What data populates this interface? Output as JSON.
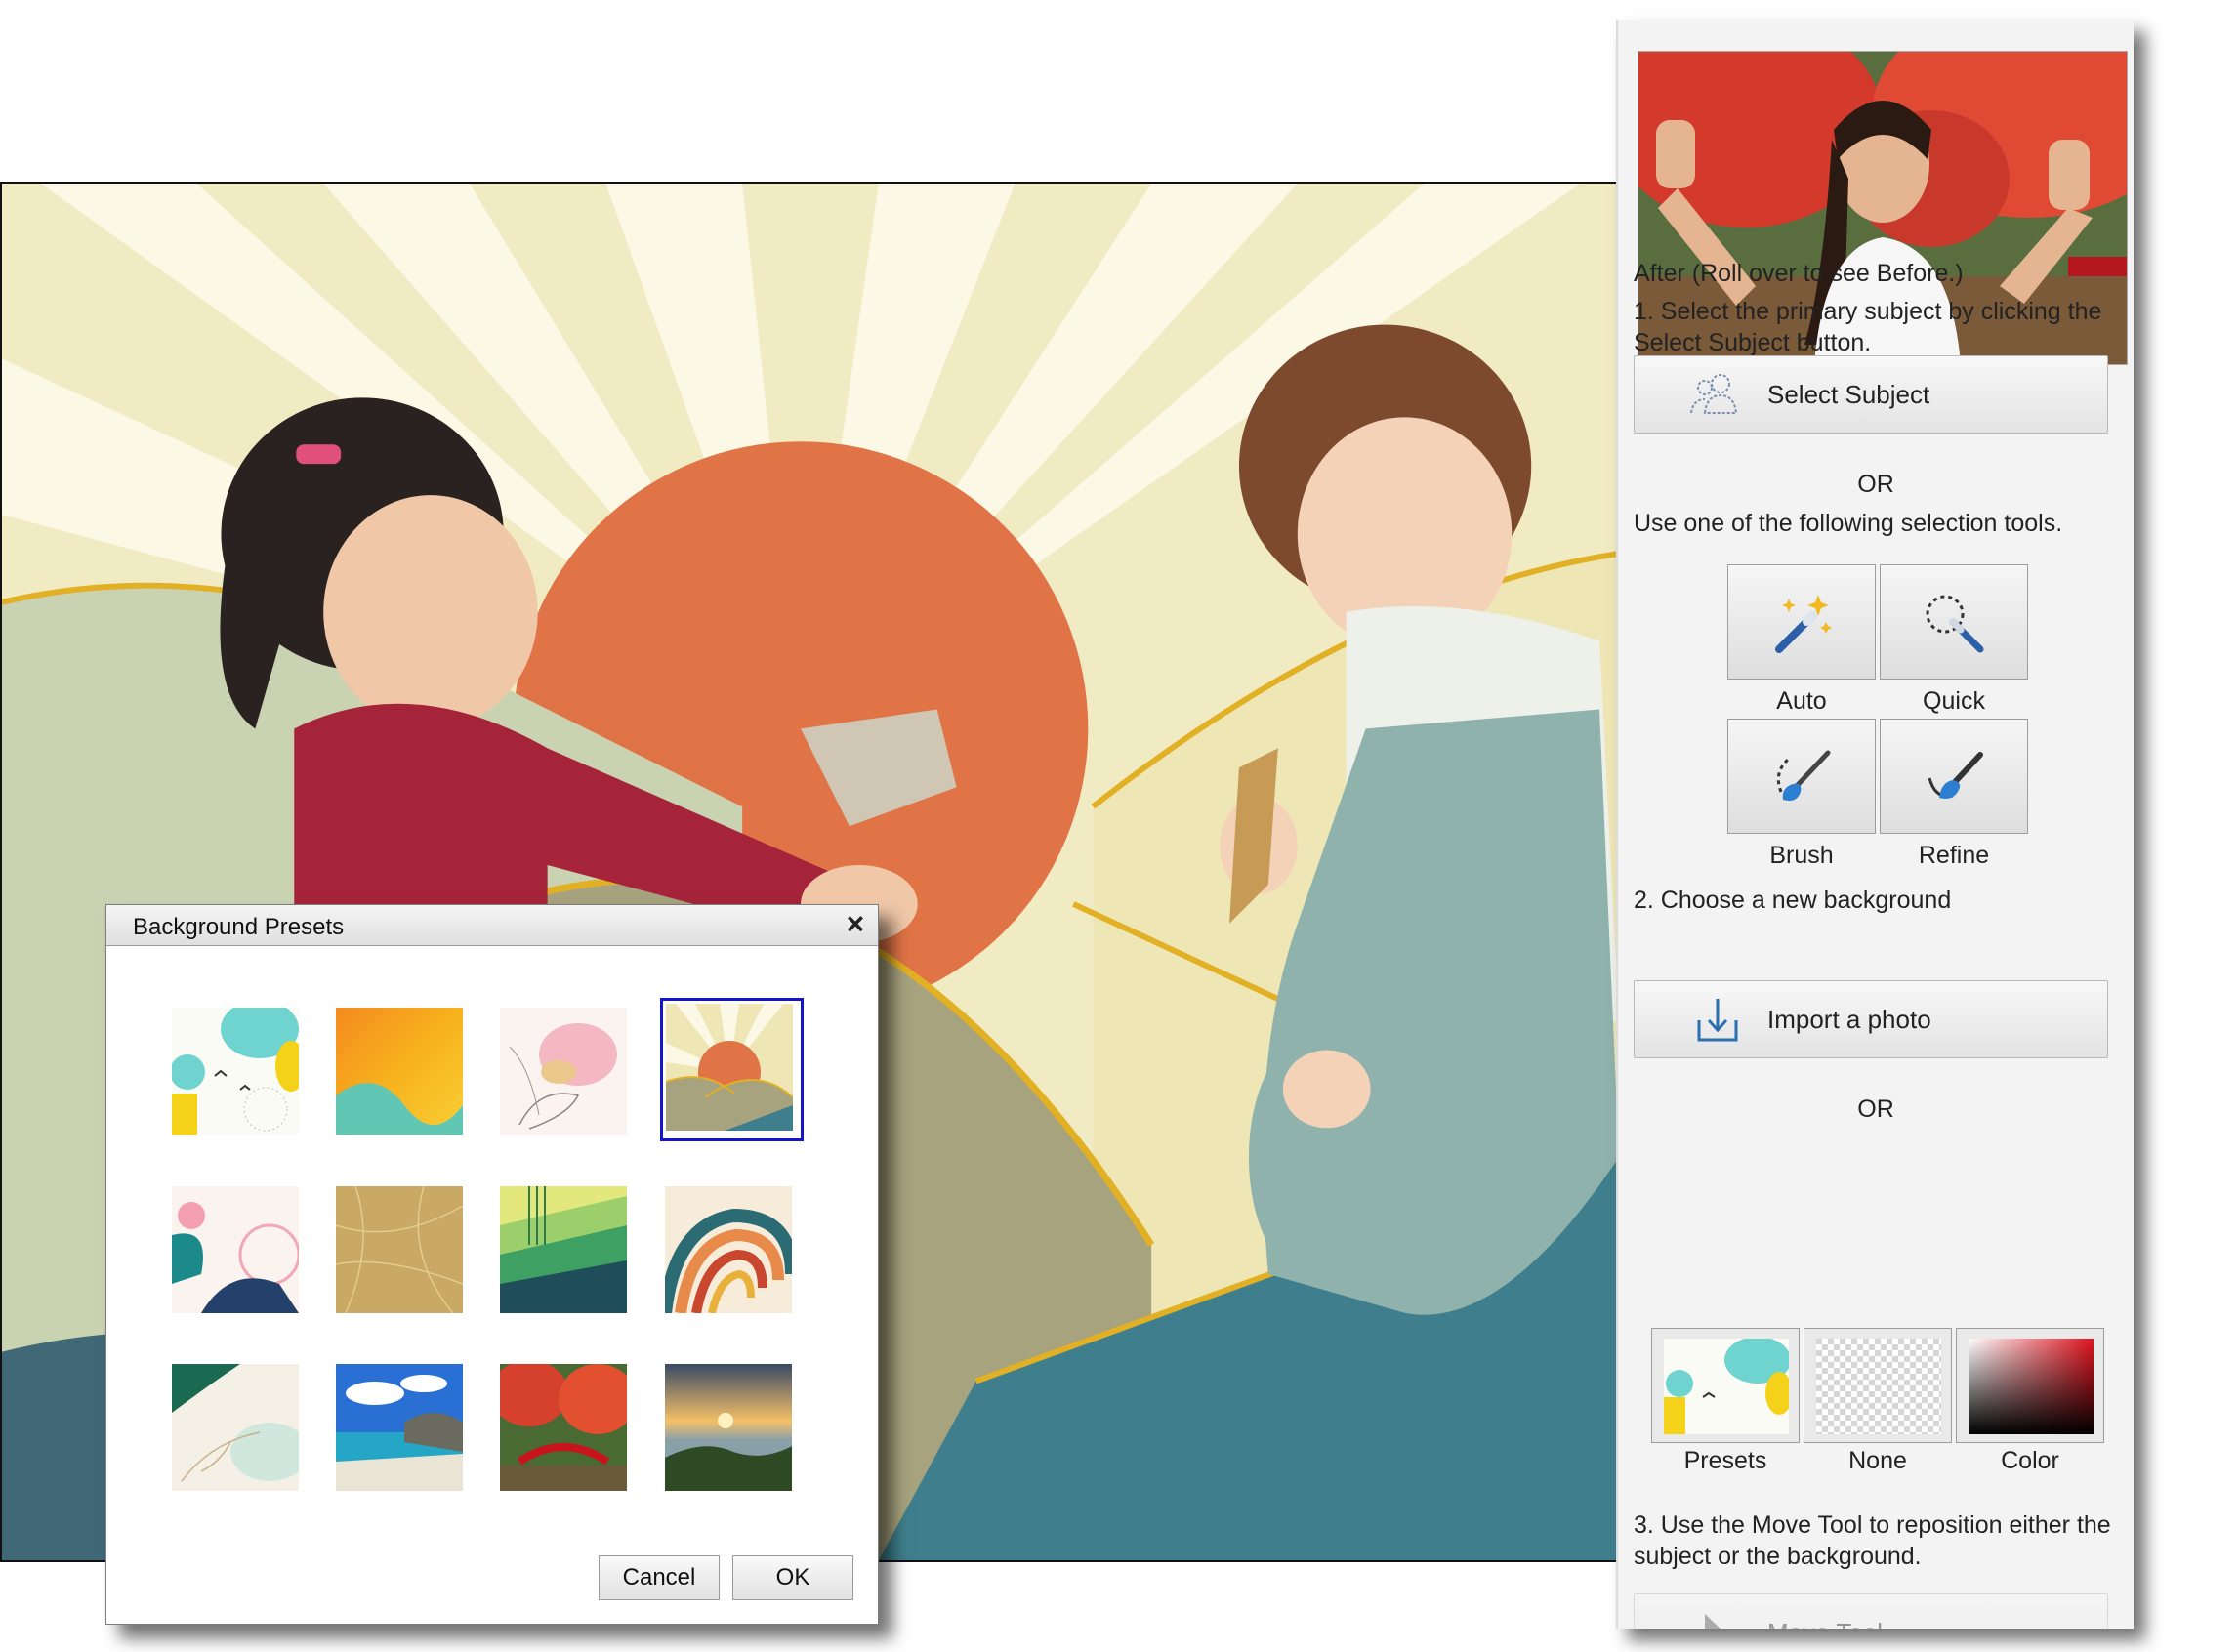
{
  "panel": {
    "preview_caption": "After (Roll over to see Before.)",
    "step1": "1. Select the primary subject by clicking the Select Subject button.",
    "select_subject_label": "Select Subject",
    "or_1": "OR",
    "use_tools": "Use one of the following selection tools.",
    "tools": [
      {
        "label": "Auto",
        "icon": "magic-wand-icon"
      },
      {
        "label": "Quick",
        "icon": "quick-selection-icon"
      },
      {
        "label": "Brush",
        "icon": "selection-brush-icon"
      },
      {
        "label": "Refine",
        "icon": "refine-brush-icon"
      }
    ],
    "step2": "2. Choose a new background",
    "import_label": "Import a photo",
    "or_2": "OR",
    "bg_options": [
      {
        "label": "Presets"
      },
      {
        "label": "None"
      },
      {
        "label": "Color"
      }
    ],
    "step3": "3. Use the Move Tool to reposition either the subject or the background.",
    "move_tool_label": "Move Tool"
  },
  "dialog": {
    "title": "Background Presets",
    "close_icon": "close-icon",
    "cancel_label": "Cancel",
    "ok_label": "OK",
    "presets": [
      {
        "name": "abstract-confetti"
      },
      {
        "name": "orange-gradient"
      },
      {
        "name": "watercolor-flower"
      },
      {
        "name": "sunrise-hills",
        "selected": true
      },
      {
        "name": "pastel-circles"
      },
      {
        "name": "gold-lines"
      },
      {
        "name": "green-stripes"
      },
      {
        "name": "retro-waves"
      },
      {
        "name": "leaf-line-art"
      },
      {
        "name": "tropical-beach"
      },
      {
        "name": "red-bridge-garden"
      },
      {
        "name": "sunset-valley"
      }
    ]
  },
  "colors": {
    "selection_highlight": "#1414c8",
    "sun": "#e07446",
    "cream": "#f1ebc4",
    "sage": "#c9d3b2",
    "olive": "#a7a37e",
    "teal": "#3f7f8d",
    "gold": "#e2b025"
  }
}
